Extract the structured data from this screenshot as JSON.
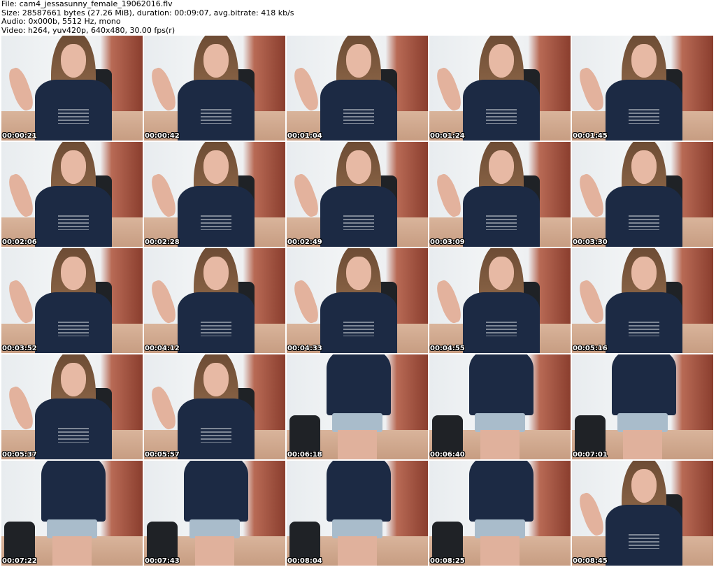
{
  "header": {
    "line1": "File: cam4_jessasunny_female_19062016.flv",
    "line2": "Size: 28587661 bytes (27.26 MiB), duration: 00:09:07, avg.bitrate: 418 kb/s",
    "line3": "Audio: 0x000b, 5512 Hz, mono",
    "line4": "Video: h264, yuv420p, 640x480, 30.00 fps(r)"
  },
  "thumbnails": [
    {
      "time": "00:00:21",
      "pose": "sit"
    },
    {
      "time": "00:00:42",
      "pose": "sit"
    },
    {
      "time": "00:01:04",
      "pose": "sit"
    },
    {
      "time": "00:01:24",
      "pose": "sit"
    },
    {
      "time": "00:01:45",
      "pose": "sit"
    },
    {
      "time": "00:02:06",
      "pose": "sit"
    },
    {
      "time": "00:02:28",
      "pose": "sit"
    },
    {
      "time": "00:02:49",
      "pose": "sit"
    },
    {
      "time": "00:03:09",
      "pose": "sit"
    },
    {
      "time": "00:03:30",
      "pose": "sit"
    },
    {
      "time": "00:03:52",
      "pose": "sit"
    },
    {
      "time": "00:04:12",
      "pose": "sit"
    },
    {
      "time": "00:04:33",
      "pose": "sit"
    },
    {
      "time": "00:04:55",
      "pose": "sit"
    },
    {
      "time": "00:05:16",
      "pose": "sit"
    },
    {
      "time": "00:05:37",
      "pose": "sit"
    },
    {
      "time": "00:05:57",
      "pose": "sit"
    },
    {
      "time": "00:06:18",
      "pose": "stand"
    },
    {
      "time": "00:06:40",
      "pose": "stand"
    },
    {
      "time": "00:07:01",
      "pose": "stand"
    },
    {
      "time": "00:07:22",
      "pose": "stand"
    },
    {
      "time": "00:07:43",
      "pose": "stand"
    },
    {
      "time": "00:08:04",
      "pose": "stand"
    },
    {
      "time": "00:08:25",
      "pose": "stand"
    },
    {
      "time": "00:08:45",
      "pose": "sit"
    }
  ]
}
